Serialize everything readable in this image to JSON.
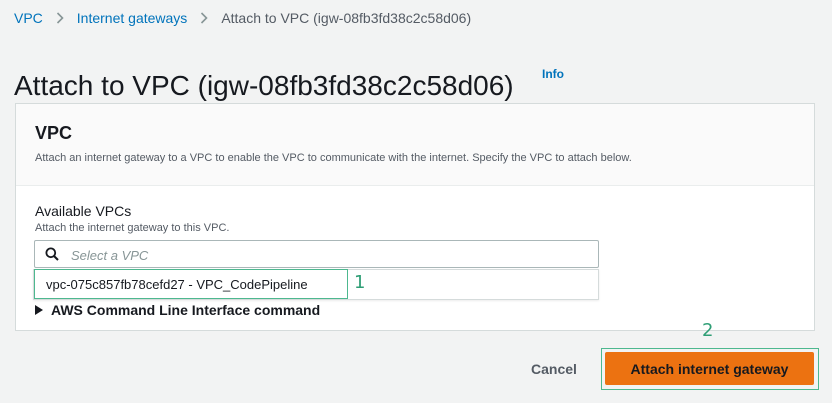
{
  "breadcrumb": {
    "items": [
      "VPC",
      "Internet gateways"
    ],
    "current": "Attach to VPC (igw-08fb3fd38c2c58d06)"
  },
  "page": {
    "title": "Attach to VPC (igw-08fb3fd38c2c58d06)",
    "info_label": "Info"
  },
  "panel": {
    "title": "VPC",
    "description": "Attach an internet gateway to a VPC to enable the VPC to communicate with the internet. Specify the VPC to attach below.",
    "field_label": "Available VPCs",
    "field_description": "Attach the internet gateway to this VPC.",
    "search_placeholder": "Select a VPC",
    "search_value": "",
    "cli_label": "AWS Command Line Interface command"
  },
  "dropdown": {
    "options": [
      "vpc-075c857fb78cefd27 - VPC_CodePipeline"
    ]
  },
  "annotations": [
    "1",
    "2"
  ],
  "footer": {
    "cancel_label": "Cancel",
    "attach_label": "Attach internet gateway"
  },
  "colors": {
    "accent_orange": "#ec7211",
    "link_blue": "#0073bb",
    "annotation_green": "#2e9e75"
  }
}
